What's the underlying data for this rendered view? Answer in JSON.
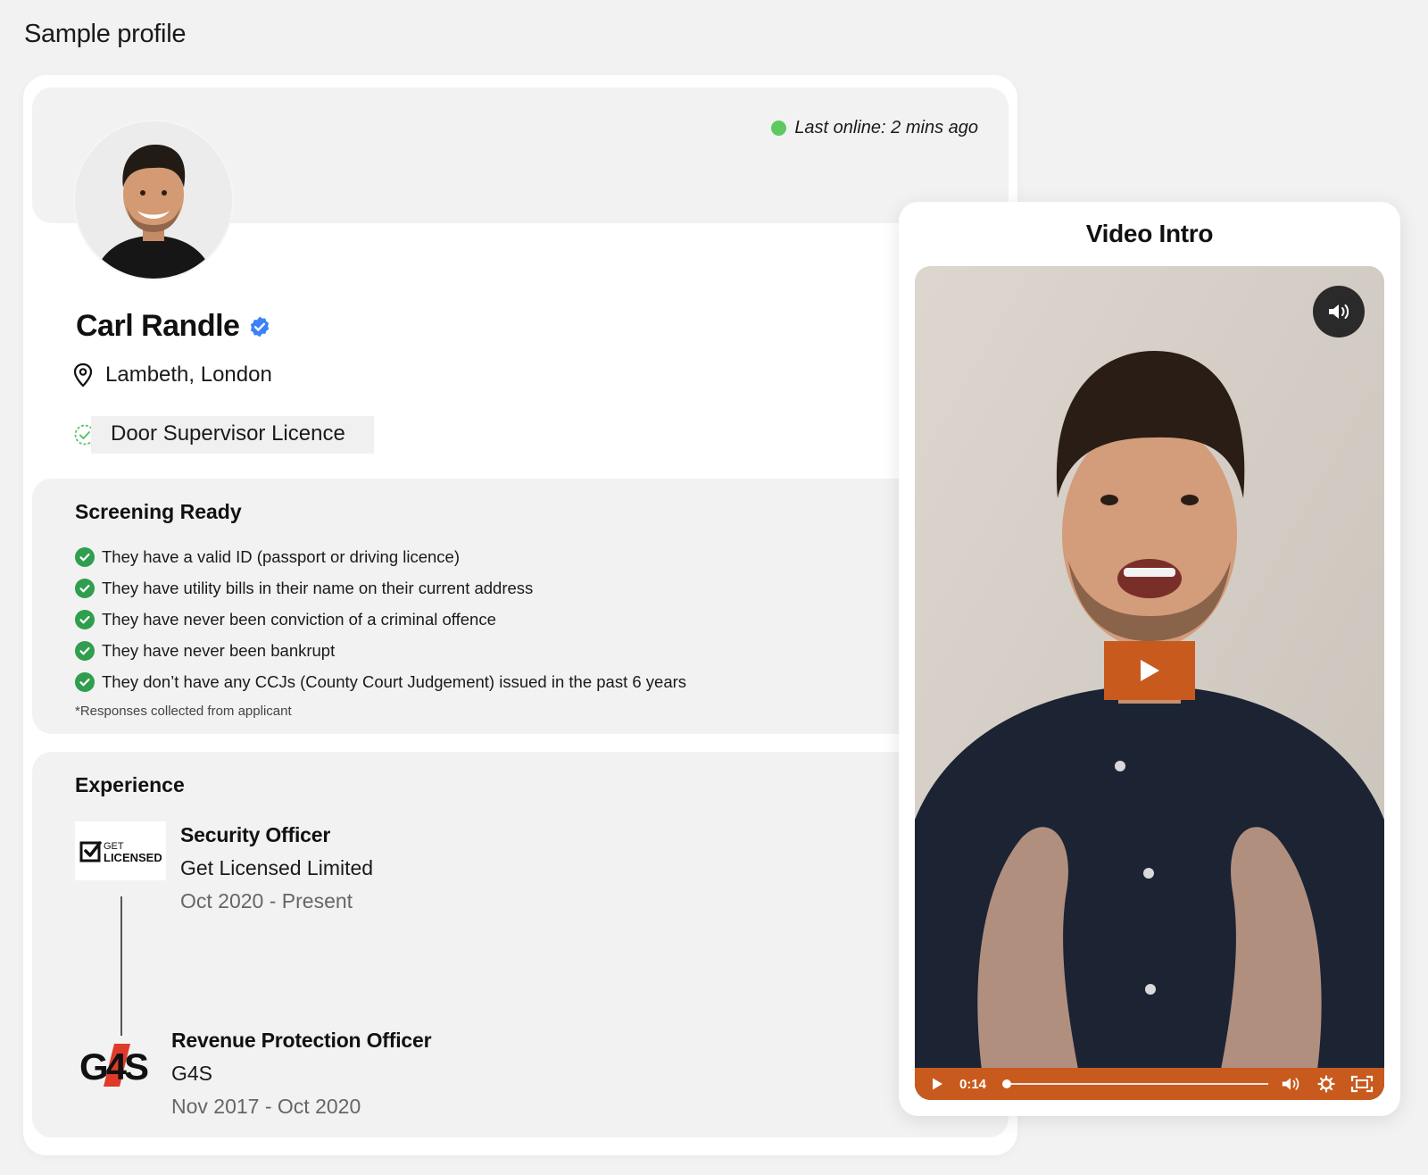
{
  "page": {
    "title": "Sample profile"
  },
  "profile": {
    "last_online": "Last online: 2 mins ago",
    "name": "Carl Randle",
    "location": "Lambeth, London",
    "licence": "Door Supervisor Licence"
  },
  "screening": {
    "title": "Screening Ready",
    "items": [
      "They have a valid ID (passport or driving licence)",
      "They have utility bills in their name on their current address",
      "They have never been conviction of a criminal offence",
      "They have never been bankrupt",
      "They don’t have any CCJs (County Court Judgement) issued in the past 6 years"
    ],
    "footnote": "*Responses collected from applicant"
  },
  "experience": {
    "title": "Experience",
    "jobs": [
      {
        "title": "Security Officer",
        "company": "Get Licensed Limited",
        "dates": "Oct 2020 - Present",
        "logo_text_top": "GET",
        "logo_text_bottom": "LICENSED"
      },
      {
        "title": "Revenue Protection Officer",
        "company": "G4S",
        "dates": "Nov 2017 - Oct 2020",
        "logo_text": "G4S"
      }
    ]
  },
  "video": {
    "title": "Video Intro",
    "time": "0:14",
    "progress": 0.01
  },
  "colors": {
    "online": "#5ec95e",
    "check": "#2f9e4e",
    "verified": "#3b82f6",
    "video_accent": "#c85a1e"
  }
}
